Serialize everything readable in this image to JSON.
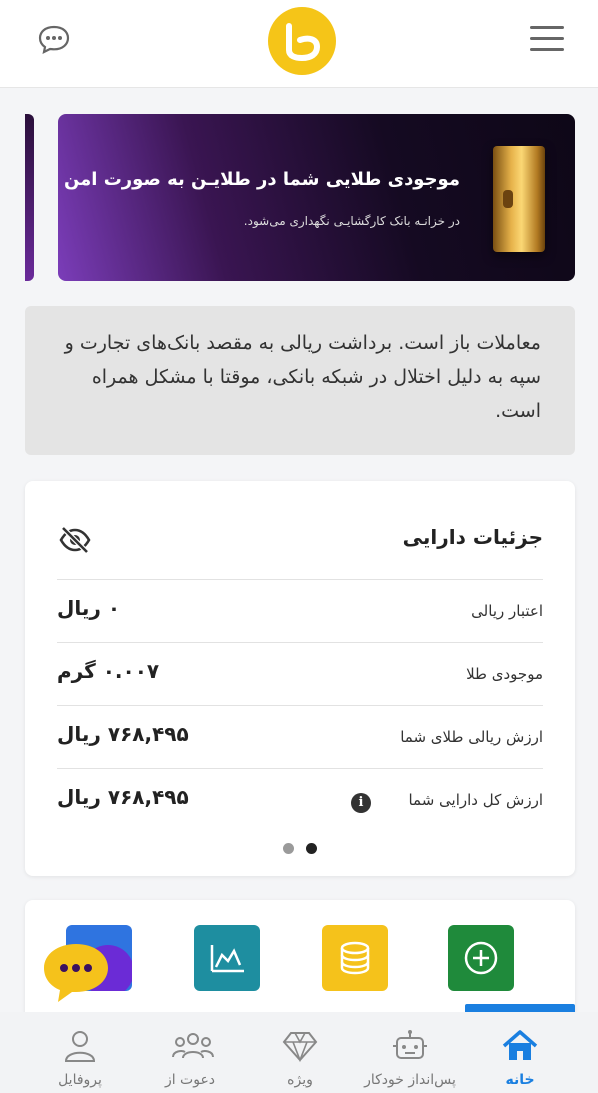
{
  "header": {
    "chat_icon": "chat-bubble-icon",
    "menu_icon": "hamburger-menu-icon",
    "logo_color": "#f5c518"
  },
  "banner": {
    "title": "موجودی طلایی شما در طلایـن به صورت امن",
    "subtitle": "در خزانـه بانک کارگشایـی نگهداری می‌شود."
  },
  "notice": {
    "text": "معاملات باز است. برداشت ریالی به مقصد بانک‌های تجارت و سپه به دلیل اختلال در شبکه بانکی، موقتا با مشکل همراه است."
  },
  "assets": {
    "title": "جزئیات دارایی",
    "visibility_icon": "eye-off-icon",
    "rows": [
      {
        "label": "اعتبار ریالی",
        "value": "۰ ریال"
      },
      {
        "label": "موجودی طلا",
        "value": "۰.۰۰۷ گرم"
      },
      {
        "label": "ارزش ریالی طلای شما",
        "value": "۷۶۸,۴۹۵ ریال"
      },
      {
        "label": "ارزش کل دارایی شما",
        "value": "۷۶۸,۴۹۵ ریال"
      }
    ],
    "info_icon": "info-icon",
    "carousel_active_index": 1
  },
  "quick_actions": [
    {
      "icon": "chart-icon",
      "color": "#1e8ea0"
    },
    {
      "icon": "coins-icon",
      "color": "#f5c21b"
    },
    {
      "icon": "plus-circle-icon",
      "color": "#1f8a3b"
    }
  ],
  "nav": {
    "items": [
      {
        "label": "خانه",
        "icon": "home-icon",
        "active": true
      },
      {
        "label": "پس‌انداز خودکار",
        "icon": "robot-icon",
        "active": false
      },
      {
        "label": "ویژه",
        "icon": "diamond-icon",
        "active": false
      },
      {
        "label": "دعوت از",
        "icon": "users-icon",
        "active": false
      },
      {
        "label": "پروفایل",
        "icon": "user-icon",
        "active": false
      }
    ]
  },
  "colors": {
    "accent": "#1a7fe0",
    "gold": "#f5c518"
  }
}
